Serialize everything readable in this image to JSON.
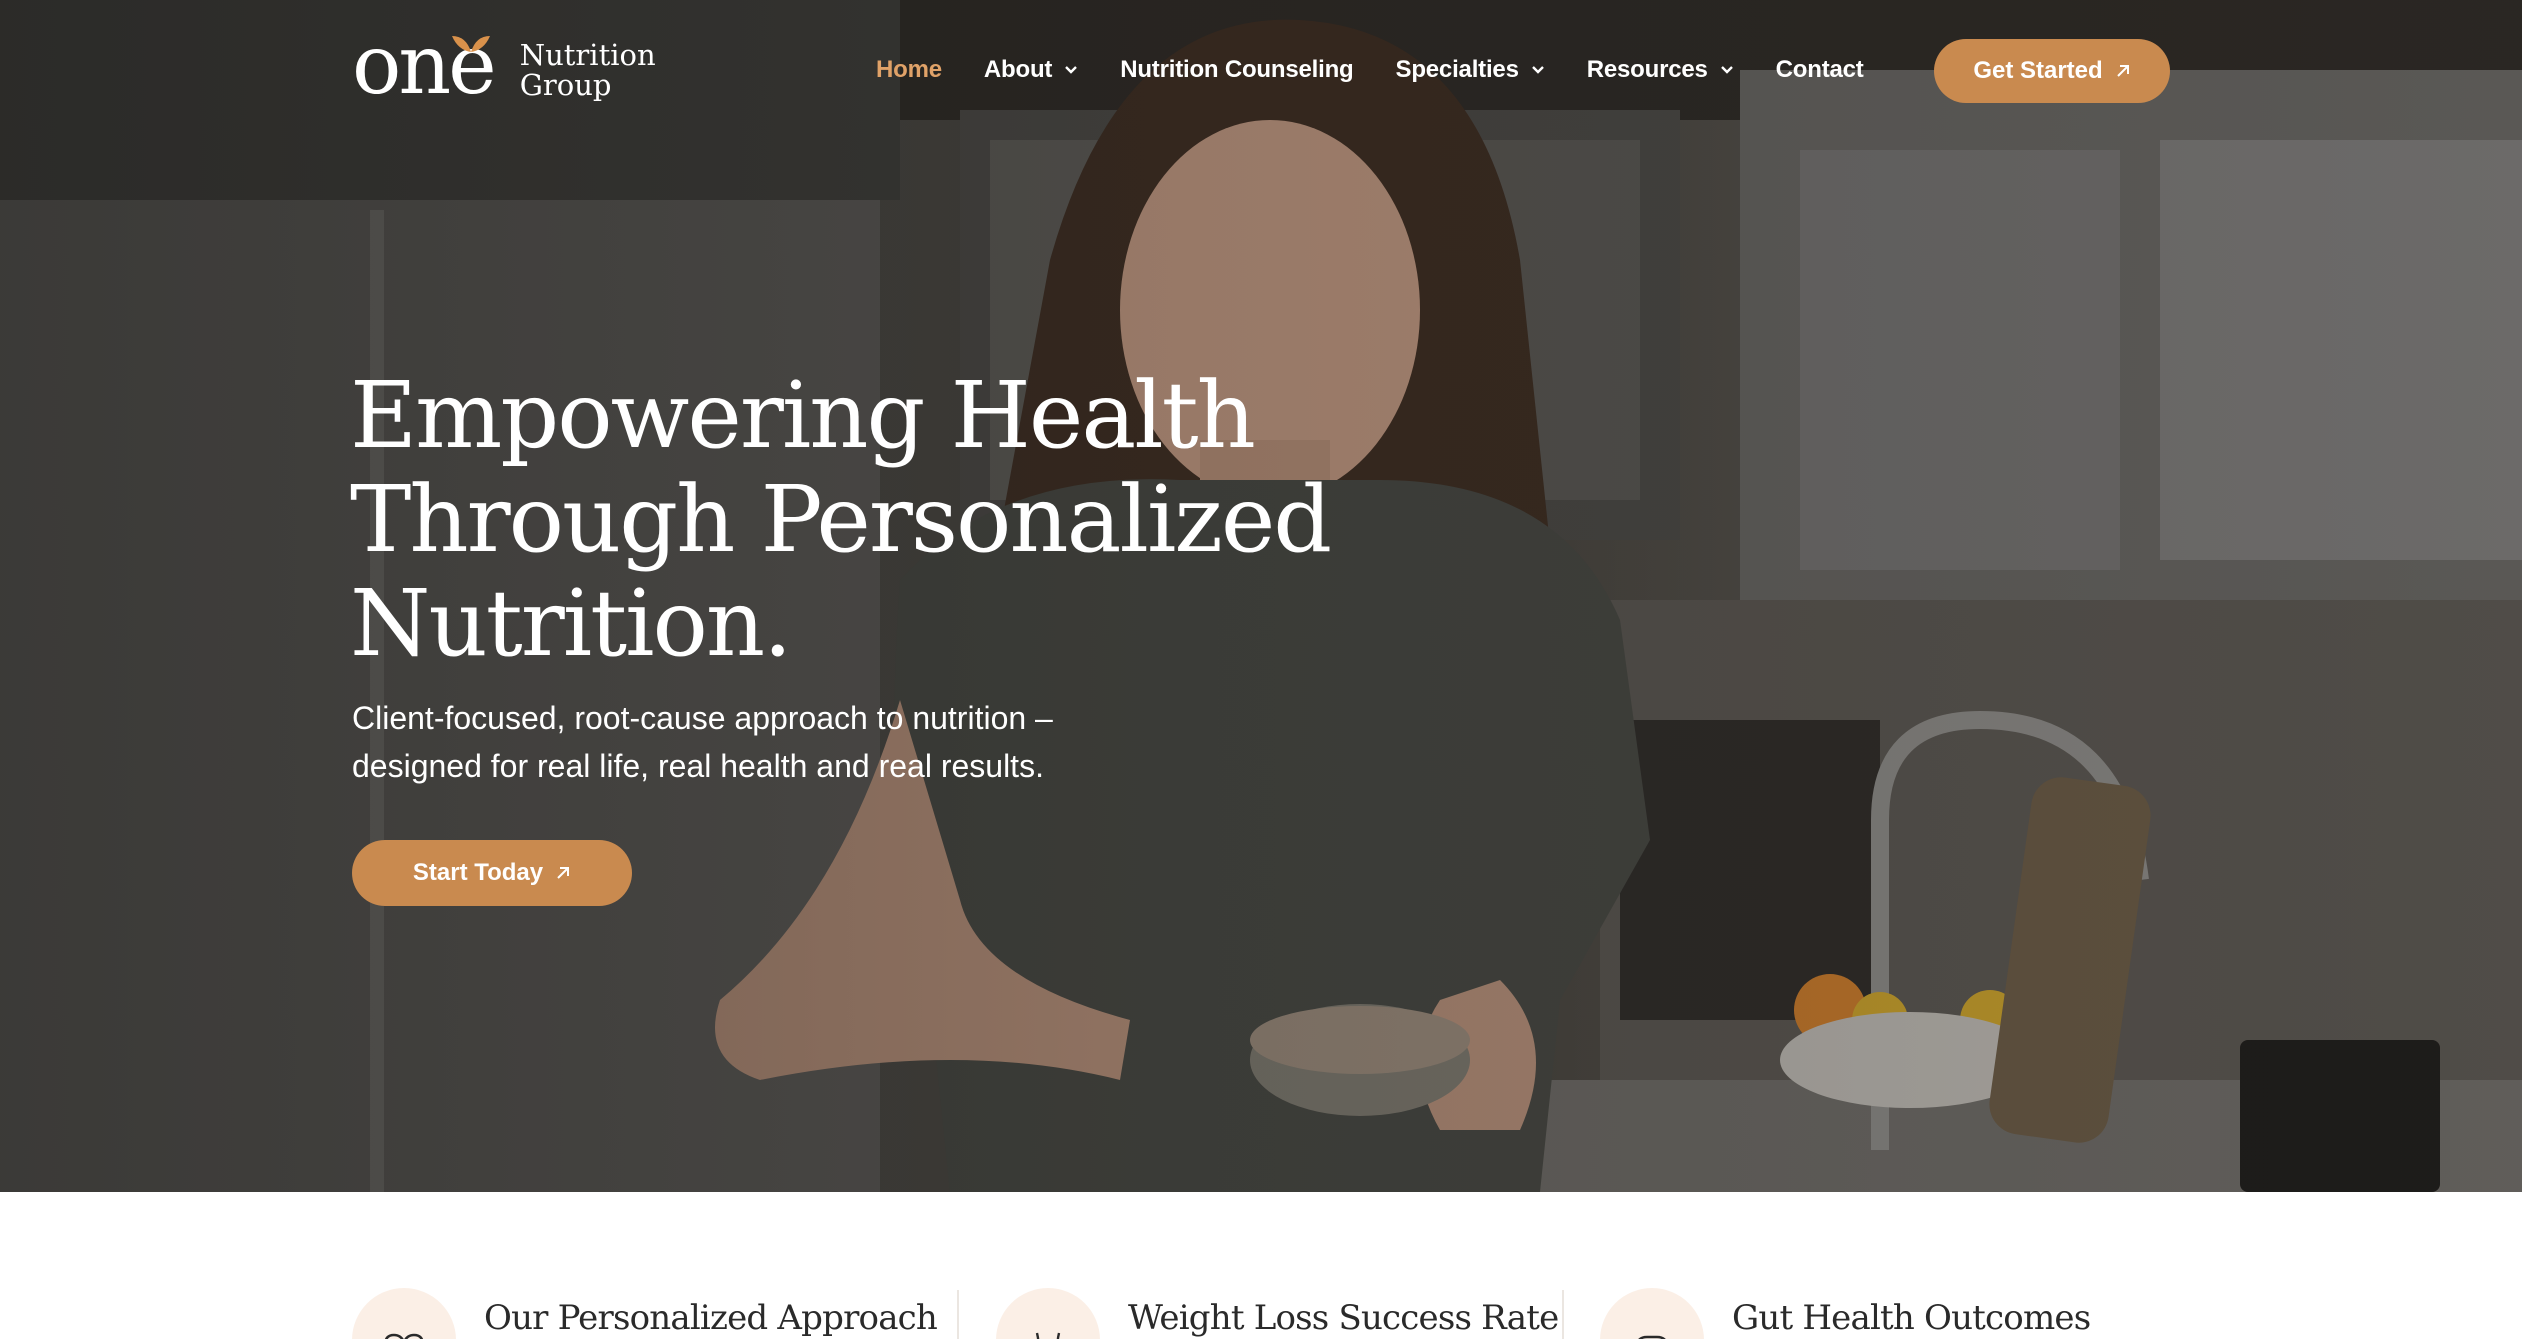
{
  "header": {
    "logo": {
      "mark": "one",
      "line1": "Nutrition",
      "line2": "Group"
    },
    "nav": [
      {
        "label": "Home",
        "active": true,
        "has_dropdown": false
      },
      {
        "label": "About",
        "active": false,
        "has_dropdown": true
      },
      {
        "label": "Nutrition Counseling",
        "active": false,
        "has_dropdown": false
      },
      {
        "label": "Specialties",
        "active": false,
        "has_dropdown": true
      },
      {
        "label": "Resources",
        "active": false,
        "has_dropdown": true
      },
      {
        "label": "Contact",
        "active": false,
        "has_dropdown": false
      }
    ],
    "cta_label": "Get Started"
  },
  "hero": {
    "headline_line1": "Empowering Health",
    "headline_line2": "Through Personalized",
    "headline_line3": "Nutrition.",
    "subhead_line1": "Client-focused, root-cause approach to nutrition –",
    "subhead_line2": "designed for real life, real health and real results.",
    "cta_label": "Start Today"
  },
  "features": [
    {
      "title": "Our Personalized Approach",
      "icon": "heart-icon"
    },
    {
      "title": "Weight Loss Success Rate",
      "icon": "waist-measure-icon"
    },
    {
      "title": "Gut Health Outcomes",
      "icon": "gut-icon"
    }
  ],
  "colors": {
    "accent": "#c98a4f",
    "nav_active": "#e0a268",
    "icon_bg": "#fbefe6",
    "text_dark": "#2a2a2a"
  }
}
